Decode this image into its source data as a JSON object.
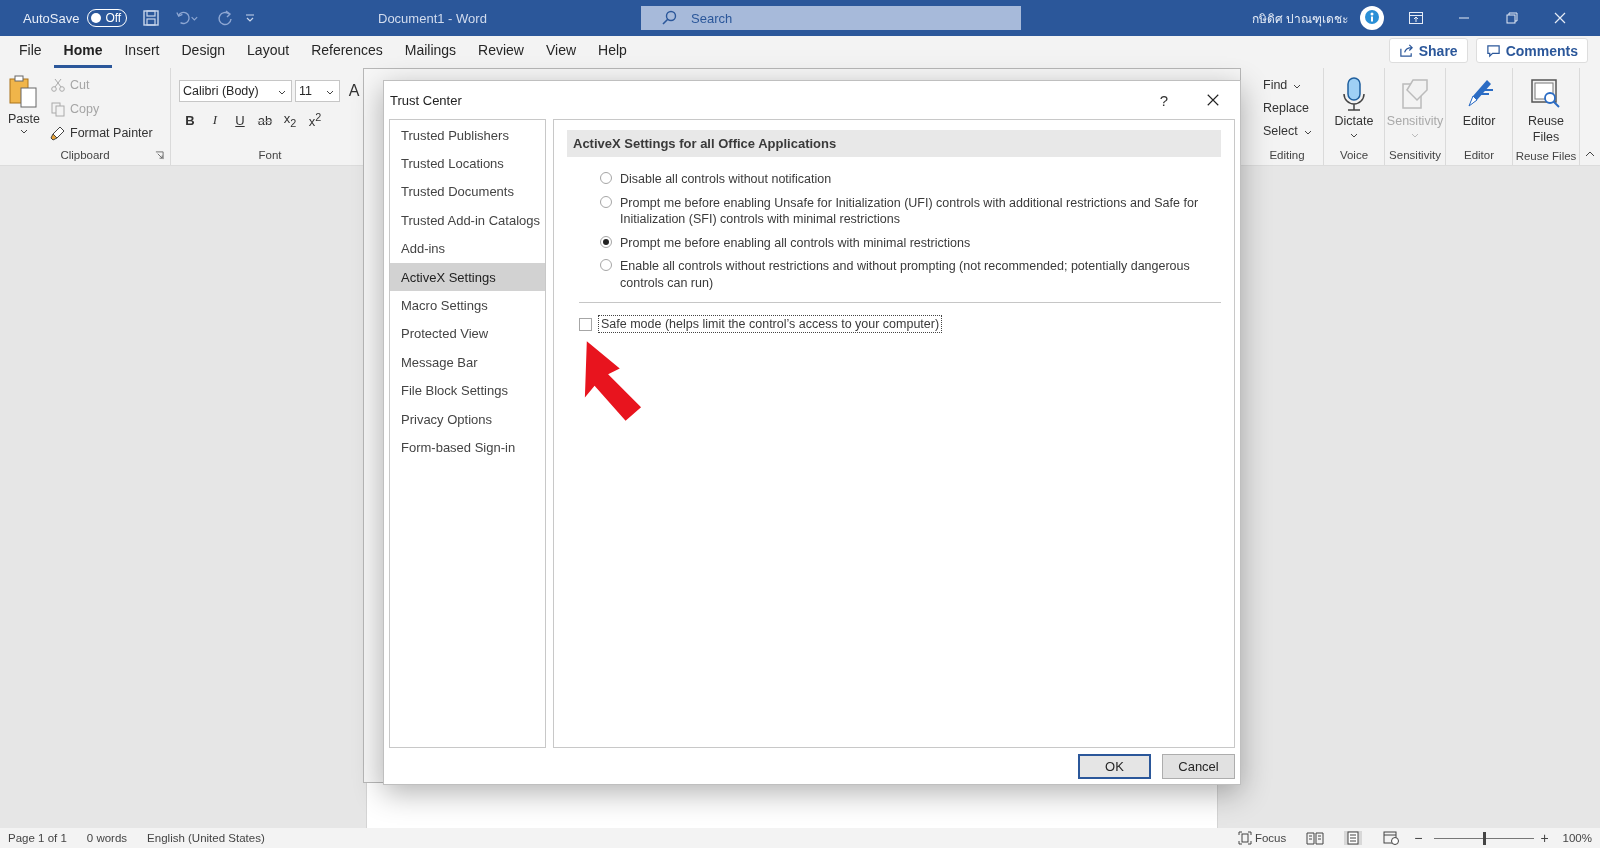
{
  "window": {
    "autosave_label": "AutoSave",
    "autosave_on": false,
    "autosave_state": "Off",
    "title": "Document1  -  Word",
    "search_placeholder": "Search",
    "user_name": "กษิดิศ ปาณฑุเดชะ"
  },
  "menu_tabs": [
    {
      "label": "File",
      "selected": false
    },
    {
      "label": "Home",
      "selected": true
    },
    {
      "label": "Insert",
      "selected": false
    },
    {
      "label": "Design",
      "selected": false
    },
    {
      "label": "Layout",
      "selected": false
    },
    {
      "label": "References",
      "selected": false
    },
    {
      "label": "Mailings",
      "selected": false
    },
    {
      "label": "Review",
      "selected": false
    },
    {
      "label": "View",
      "selected": false
    },
    {
      "label": "Help",
      "selected": false
    }
  ],
  "share": "Share",
  "comments": "Comments",
  "clipboard": {
    "paste": "Paste",
    "cut": "Cut",
    "copy": "Copy",
    "format_painter": "Format Painter",
    "label": "Clipboard"
  },
  "font": {
    "name": "Calibri (Body)",
    "size": "11",
    "grow": "A",
    "label": "Font",
    "buttons": [
      {
        "kind": "bold",
        "text": "B"
      },
      {
        "kind": "italic",
        "text": "I"
      },
      {
        "kind": "underline",
        "text": "U"
      },
      {
        "kind": "strike",
        "text": "ab"
      },
      {
        "kind": "plain",
        "text": "x$_{2}$"
      },
      {
        "kind": "plain",
        "text": "x$^{2}$"
      }
    ]
  },
  "editing": {
    "find": "Find",
    "replace": "Replace",
    "select": "Select",
    "label": "Editing"
  },
  "ribbon_groups": [
    {
      "kind": "mic",
      "button": "Dictate",
      "label": "Voice",
      "disabled": false,
      "dropdown": true
    },
    {
      "kind": "sensitivity",
      "button": "Sensitivity",
      "label": "Sensitivity",
      "disabled": true,
      "dropdown": true
    },
    {
      "kind": "editor",
      "button": "Editor",
      "label": "Editor",
      "disabled": false,
      "dropdown": false
    },
    {
      "kind": "reuse",
      "button": "Reuse Files",
      "label": "Reuse Files",
      "disabled": false,
      "dropdown": false
    }
  ],
  "dialog": {
    "title": "Trust Center",
    "help": "?",
    "nav": [
      {
        "label": "Trusted Publishers",
        "selected": false
      },
      {
        "label": "Trusted Locations",
        "selected": false
      },
      {
        "label": "Trusted Documents",
        "selected": false
      },
      {
        "label": "Trusted Add-in Catalogs",
        "selected": false
      },
      {
        "label": "Add-ins",
        "selected": false
      },
      {
        "label": "ActiveX Settings",
        "selected": true
      },
      {
        "label": "Macro Settings",
        "selected": false
      },
      {
        "label": "Protected View",
        "selected": false
      },
      {
        "label": "Message Bar",
        "selected": false
      },
      {
        "label": "File Block Settings",
        "selected": false
      },
      {
        "label": "Privacy Options",
        "selected": false
      },
      {
        "label": "Form-based Sign-in",
        "selected": false
      }
    ],
    "section_title": "ActiveX Settings for all Office Applications",
    "options": [
      {
        "label": "Disable all controls without notification",
        "selected": false
      },
      {
        "label": "Prompt me before enabling Unsafe for Initialization (UFI) controls with additional restrictions and Safe for Initialization (SFI) controls with minimal restrictions",
        "selected": false
      },
      {
        "label": "Prompt me before enabling all controls with minimal restrictions",
        "selected": true
      },
      {
        "label": "Enable all controls without restrictions and without prompting (not recommended; potentially dangerous controls can run)",
        "selected": false
      }
    ],
    "safe_mode": {
      "label": "Safe mode (helps limit the control’s access to your computer)",
      "checked": false
    },
    "buttons": [
      {
        "label": "OK",
        "default": true
      },
      {
        "label": "Cancel",
        "default": false
      }
    ]
  },
  "status_bar": {
    "page": "Page 1 of 1",
    "words": "0 words",
    "language": "English (United States)",
    "focus": "Focus",
    "zoom_out": "−",
    "zoom_in": "+",
    "zoom": "100%",
    "level": 0.5
  }
}
